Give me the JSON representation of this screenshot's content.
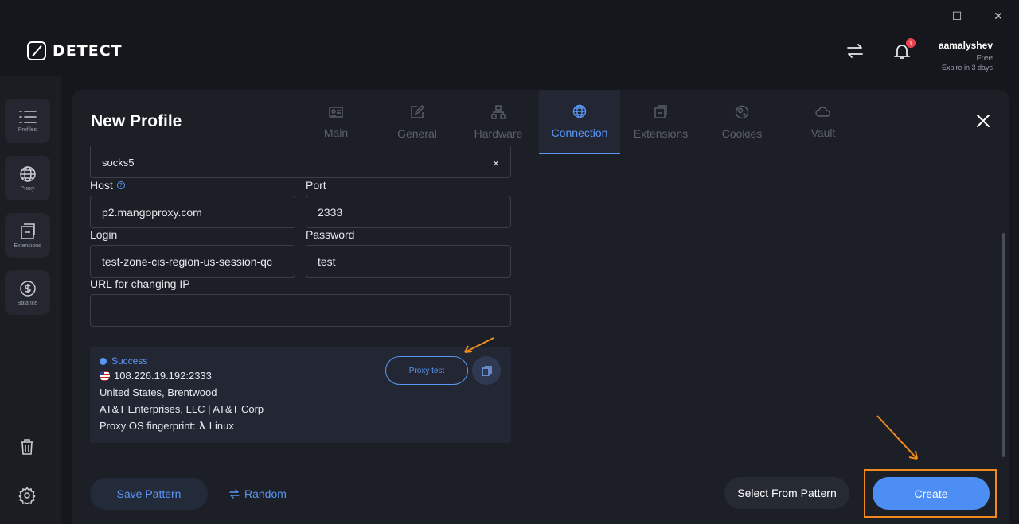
{
  "window": {
    "minimize": "—",
    "maximize": "☐",
    "close": "✕"
  },
  "brand": {
    "name": "DETECT"
  },
  "header": {
    "notifications_count": "1",
    "user": {
      "name": "aamalyshev",
      "plan": "Free",
      "expire": "Expire in 3 days"
    }
  },
  "sidebar": {
    "items": [
      {
        "label": "Profiles"
      },
      {
        "label": "Proxy"
      },
      {
        "label": "Extensions"
      },
      {
        "label": "Balance"
      }
    ]
  },
  "panel": {
    "title": "New Profile",
    "tabs": [
      {
        "label": "Main"
      },
      {
        "label": "General"
      },
      {
        "label": "Hardware"
      },
      {
        "label": "Connection"
      },
      {
        "label": "Extensions"
      },
      {
        "label": "Cookies"
      },
      {
        "label": "Vault"
      }
    ],
    "active_tab": "Connection"
  },
  "form": {
    "proxy_type": {
      "value": "socks5",
      "clear": "×"
    },
    "host": {
      "label": "Host",
      "value": "p2.mangoproxy.com"
    },
    "port": {
      "label": "Port",
      "value": "2333"
    },
    "login": {
      "label": "Login",
      "value": "test-zone-cis-region-us-session-qc"
    },
    "password": {
      "label": "Password",
      "value": "test"
    },
    "change_ip_url": {
      "label": "URL for changing IP",
      "value": ""
    }
  },
  "result": {
    "status": "Success",
    "ip": "108.226.19.192:2333",
    "location": "United States, Brentwood",
    "isp": "AT&T Enterprises, LLC | AT&T Corp",
    "fingerprint": "Proxy OS fingerprint:",
    "os": "Linux",
    "proxy_test_label": "Proxy test"
  },
  "actions": {
    "save_pattern": "Save Pattern",
    "random": "Random",
    "select_from_pattern": "Select From Pattern",
    "create": "Create"
  },
  "colors": {
    "accent": "#4c8ef3",
    "annotation": "#f08a1c",
    "badge": "#e9434f"
  }
}
